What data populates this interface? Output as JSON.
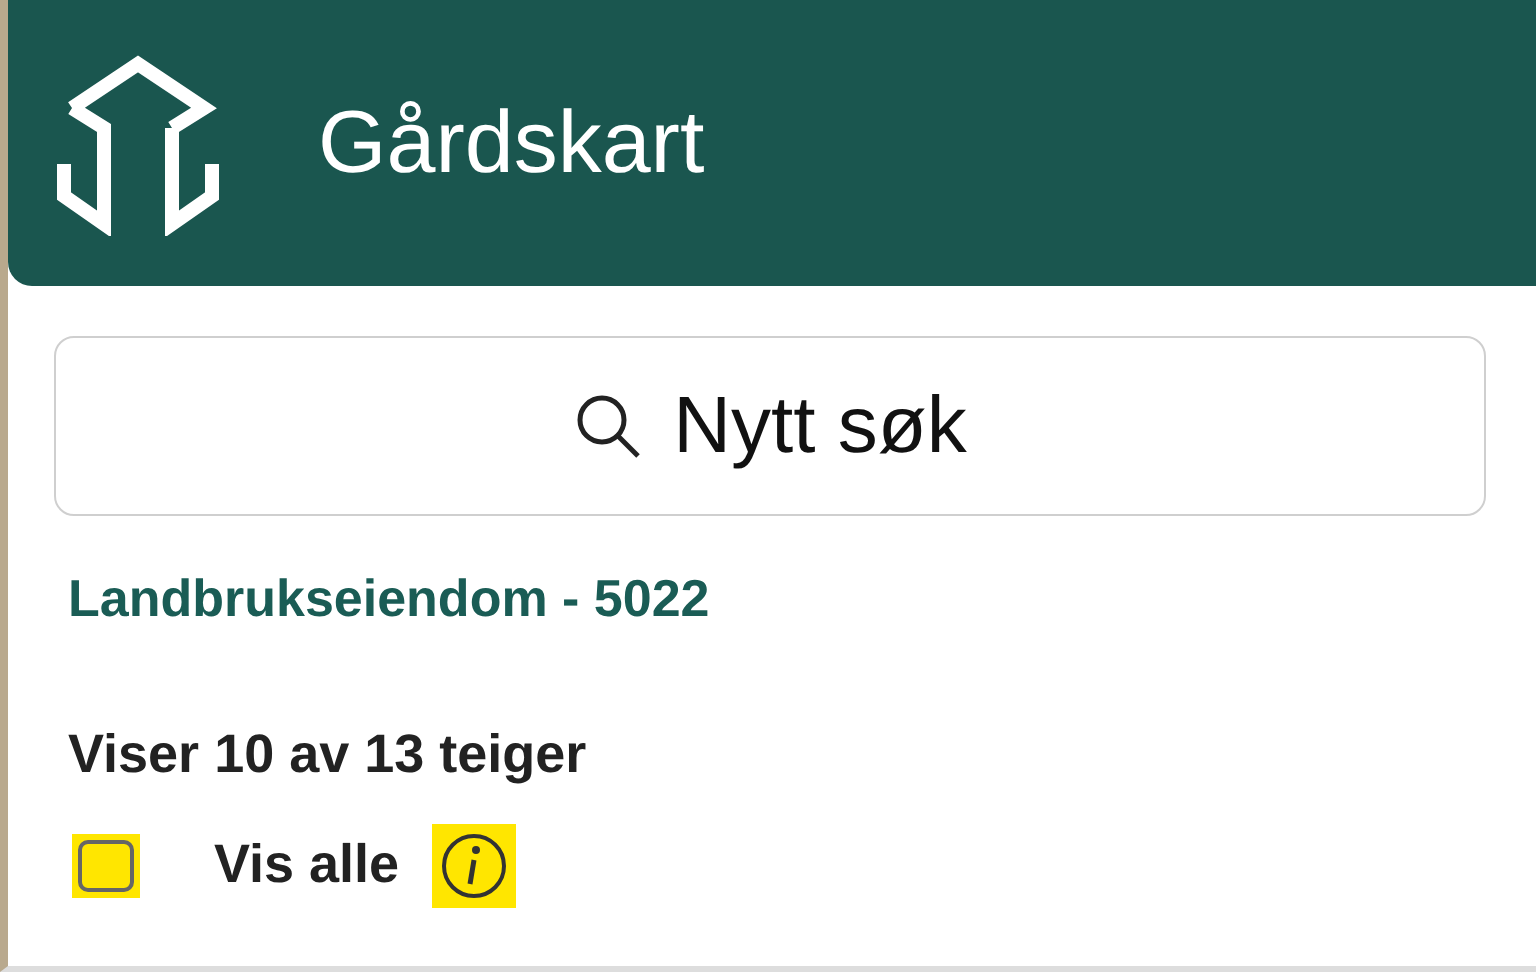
{
  "header": {
    "title": "Gårdskart"
  },
  "search_button": {
    "label": "Nytt søk"
  },
  "property_link": "Landbrukseiendom - 5022",
  "summary": "Viser 10 av 13 teiger",
  "show_all": {
    "label": "Vis alle",
    "checked": false
  }
}
